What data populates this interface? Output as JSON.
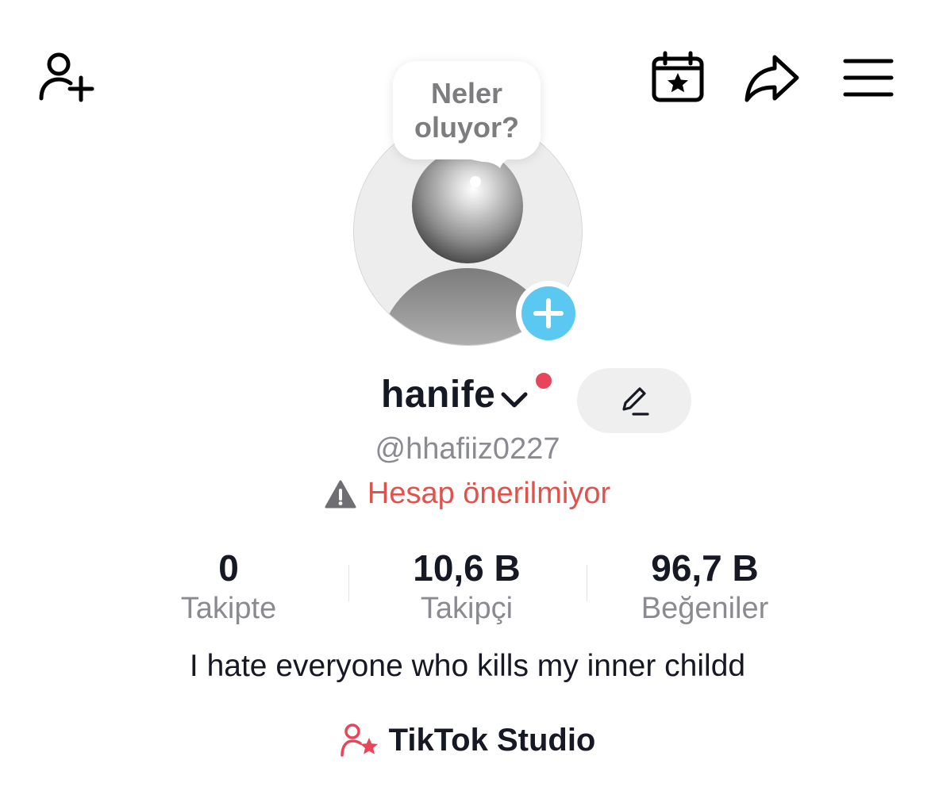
{
  "header": {
    "icons": {
      "add_friend": "person-plus-icon",
      "calendar": "calendar-star-icon",
      "share": "share-arrow-icon",
      "menu": "hamburger-menu-icon"
    }
  },
  "status_bubble": {
    "text": "Neler oluyor?"
  },
  "profile": {
    "display_name": "hanife",
    "username": "@hhafiiz0227",
    "warning": "Hesap önerilmiyor",
    "bio": "I hate everyone who kills my inner childd"
  },
  "stats": [
    {
      "value": "0",
      "label": "Takipte"
    },
    {
      "value": "10,6 B",
      "label": "Takipçi"
    },
    {
      "value": "96,7 B",
      "label": "Beğeniler"
    }
  ],
  "studio_link": {
    "label": "TikTok Studio"
  },
  "colors": {
    "accent_blue": "#5ac8f0",
    "notification_red": "#e8445a",
    "warning_red": "#e0524c",
    "secondary_text": "#8a8b91",
    "studio_icon": "#e8445a"
  }
}
